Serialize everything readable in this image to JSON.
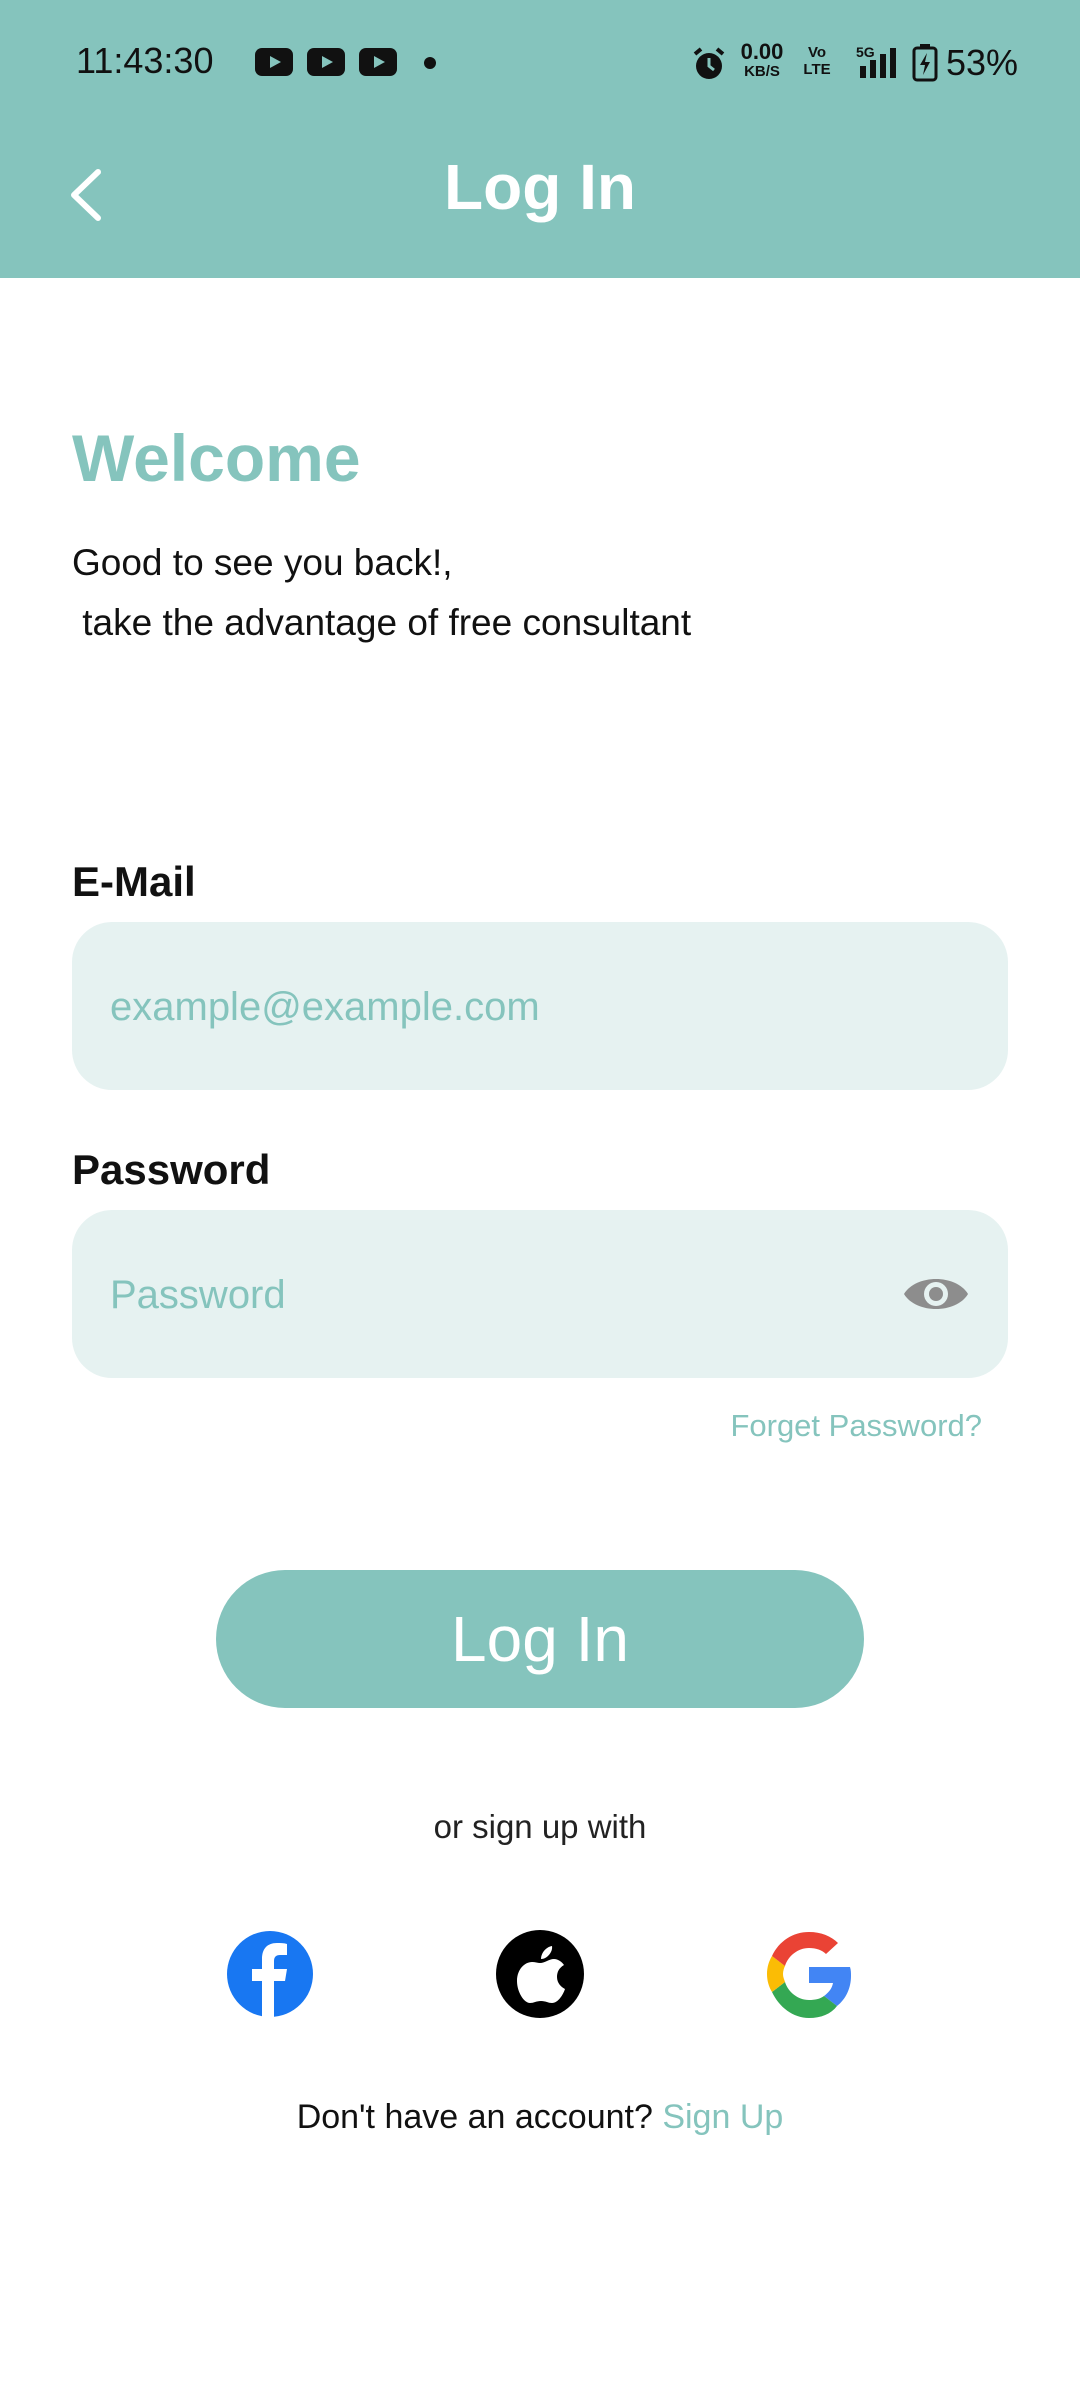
{
  "status_bar": {
    "time": "11:43:30",
    "speed_value": "0.00",
    "speed_unit": "KB/S",
    "volte_top": "Vo",
    "volte_bottom": "LTE",
    "network": "5G",
    "battery": "53%",
    "icons": [
      "youtube-icon",
      "youtube-icon",
      "youtube-icon",
      "notification-dot",
      "alarm-icon",
      "signal-icon",
      "battery-icon"
    ]
  },
  "header": {
    "title": "Log In",
    "back_icon": "chevron-left-icon"
  },
  "welcome": {
    "title": "Welcome",
    "line1": "Good to see you back!,",
    "line2": " take the advantage of free consultant"
  },
  "form": {
    "email_label": "E-Mail",
    "email_placeholder": "example@example.com",
    "password_label": "Password",
    "password_placeholder": "Password",
    "forgot_label": "Forget Password?",
    "login_label": "Log In"
  },
  "social": {
    "divider_text": "or sign up with",
    "providers": [
      "facebook-icon",
      "apple-icon",
      "google-icon"
    ]
  },
  "footer": {
    "prompt": "Don't have an account? ",
    "signup_label": "Sign Up"
  },
  "colors": {
    "accent": "#85c4bd",
    "field_bg": "#e6f2f1",
    "facebook": "#1877f2"
  }
}
